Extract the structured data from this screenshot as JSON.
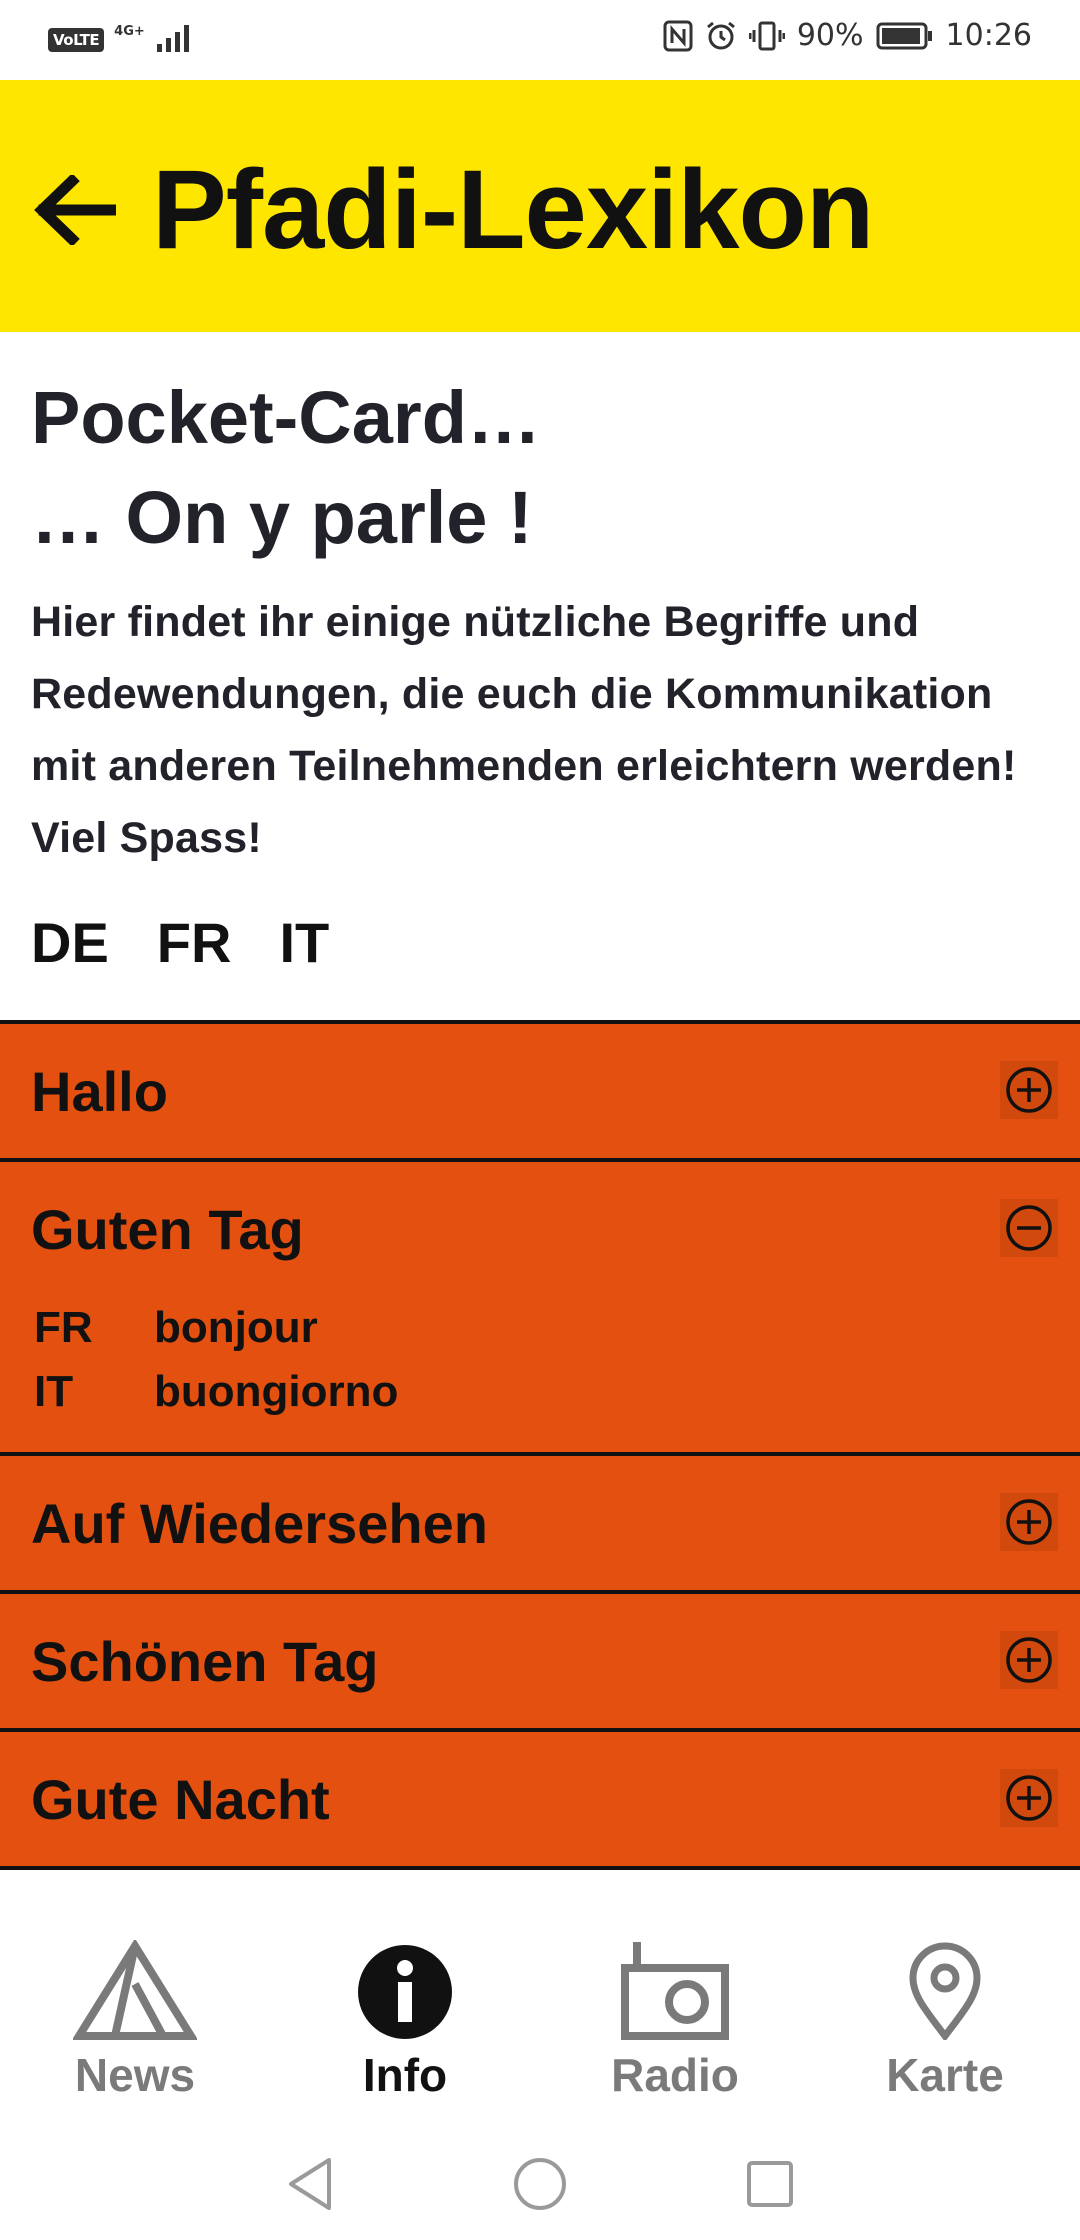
{
  "status_bar": {
    "left_badge": "VoLTE",
    "network": "4G+",
    "battery_percent": "90%",
    "time": "10:26"
  },
  "header": {
    "title": "Pfadi-Lexikon",
    "background": "#ffe600"
  },
  "intro": {
    "heading_line1": "Pocket-Card…",
    "heading_line2": "… On y parle !",
    "text": "Hier findet ihr einige nützliche Begriffe und Redewendungen, die euch die Kommunikation mit anderen Teilnehmenden erleichtern werden! Viel Spass!"
  },
  "languages": [
    "DE",
    "FR",
    "IT"
  ],
  "accordion": {
    "accent": "#e3500f",
    "items": [
      {
        "title": "Hallo",
        "expanded": false
      },
      {
        "title": "Guten Tag",
        "expanded": true,
        "translations": [
          {
            "code": "FR",
            "text": "bonjour"
          },
          {
            "code": "IT",
            "text": "buongiorno"
          }
        ]
      },
      {
        "title": "Auf Wiedersehen",
        "expanded": false
      },
      {
        "title": "Schönen Tag",
        "expanded": false
      },
      {
        "title": "Gute Nacht",
        "expanded": false
      }
    ]
  },
  "bottom_nav": {
    "items": [
      {
        "label": "News",
        "icon": "tent-icon",
        "active": false
      },
      {
        "label": "Info",
        "icon": "info-icon",
        "active": true
      },
      {
        "label": "Radio",
        "icon": "radio-icon",
        "active": false
      },
      {
        "label": "Karte",
        "icon": "map-pin-icon",
        "active": false
      }
    ]
  }
}
